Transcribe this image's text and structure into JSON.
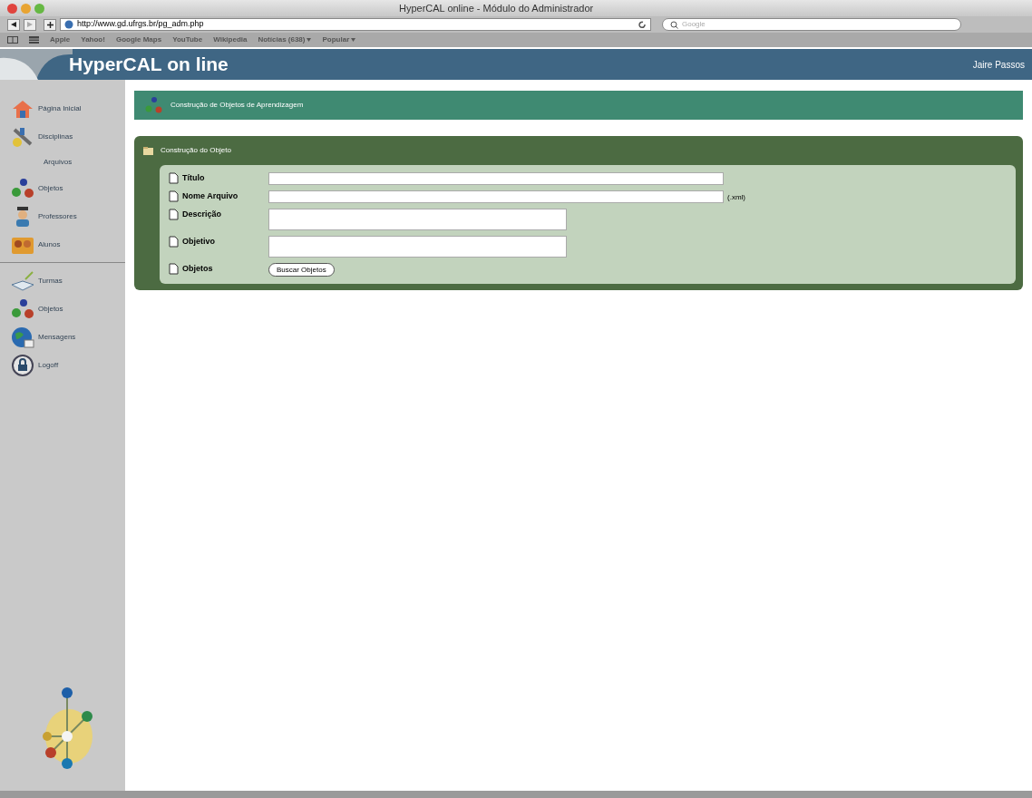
{
  "window": {
    "title": "HyperCAL online - Módulo do Administrador"
  },
  "toolbar": {
    "url": "http://www.gd.ufrgs.br/pg_adm.php",
    "search_placeholder": "Google"
  },
  "bookmarks": [
    {
      "label": "Apple",
      "menu": false
    },
    {
      "label": "Yahoo!",
      "menu": false
    },
    {
      "label": "Google Maps",
      "menu": false
    },
    {
      "label": "YouTube",
      "menu": false
    },
    {
      "label": "Wikipedia",
      "menu": false
    },
    {
      "label": "Notícias (638)",
      "menu": true
    },
    {
      "label": "Popular",
      "menu": true
    }
  ],
  "header": {
    "title": "HyperCAL on line",
    "user": "Jaire Passos"
  },
  "sidebar": {
    "sections": [
      [
        {
          "label": "Página Inicial"
        },
        {
          "label": "Disciplinas",
          "children": [
            {
              "label": "Arquivos"
            }
          ]
        },
        {
          "label": "Objetos"
        },
        {
          "label": "Professores"
        },
        {
          "label": "Alunos"
        }
      ],
      [
        {
          "label": "Turmas"
        },
        {
          "label": "Objetos"
        },
        {
          "label": "Mensagens"
        },
        {
          "label": "Logoff"
        }
      ]
    ]
  },
  "page_title": "Construção de Objetos de Aprendizagem",
  "panel": {
    "title": "Construção do Objeto",
    "rows": [
      {
        "label": "Título",
        "kind": "text"
      },
      {
        "label": "Nome Arquivo",
        "kind": "text",
        "suffix": "(.xml)"
      },
      {
        "label": "Descrição",
        "kind": "textarea"
      },
      {
        "label": "Objetivo",
        "kind": "textarea"
      },
      {
        "label": "Objetos",
        "kind": "button",
        "button": "Buscar Objetos"
      }
    ]
  }
}
